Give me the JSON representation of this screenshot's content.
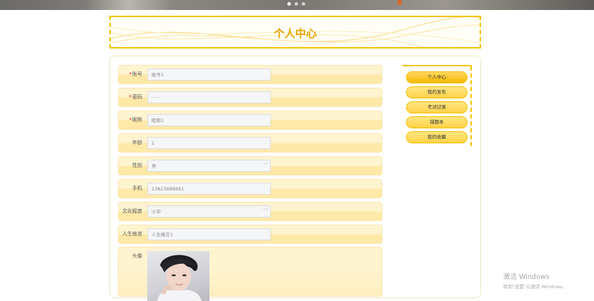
{
  "carousel": {
    "slide_count": 3,
    "active_slide": 1
  },
  "page": {
    "title": "个人中心"
  },
  "form": {
    "rows": [
      {
        "label": "账号",
        "required": true,
        "type": "input",
        "value": "账号1"
      },
      {
        "label": "密码",
        "required": true,
        "type": "input",
        "value": "······"
      },
      {
        "label": "昵称",
        "required": true,
        "type": "input",
        "value": "昵称1"
      },
      {
        "label": "年龄",
        "required": false,
        "type": "input",
        "value": "1"
      },
      {
        "label": "性别",
        "required": false,
        "type": "select",
        "value": "男"
      },
      {
        "label": "手机",
        "required": false,
        "type": "input",
        "value": "13823888881"
      },
      {
        "label": "文化程度",
        "required": false,
        "type": "select",
        "value": "小学"
      },
      {
        "label": "人生格言",
        "required": false,
        "type": "input",
        "value": "人生格言1"
      }
    ],
    "avatar": {
      "label": "头像"
    }
  },
  "side_menu": {
    "items": [
      {
        "label": "个人中心",
        "active": true
      },
      {
        "label": "我的发布",
        "active": false
      },
      {
        "label": "考试记录",
        "active": false
      },
      {
        "label": "错题本",
        "active": false
      },
      {
        "label": "我的收藏",
        "active": false
      }
    ]
  },
  "watermark": {
    "line1": "激活 Windows",
    "line2": "转到\"设置\"以激活 Windows。"
  },
  "colors": {
    "accent": "#f5c400",
    "title": "#e6a400",
    "required": "#e60012"
  }
}
